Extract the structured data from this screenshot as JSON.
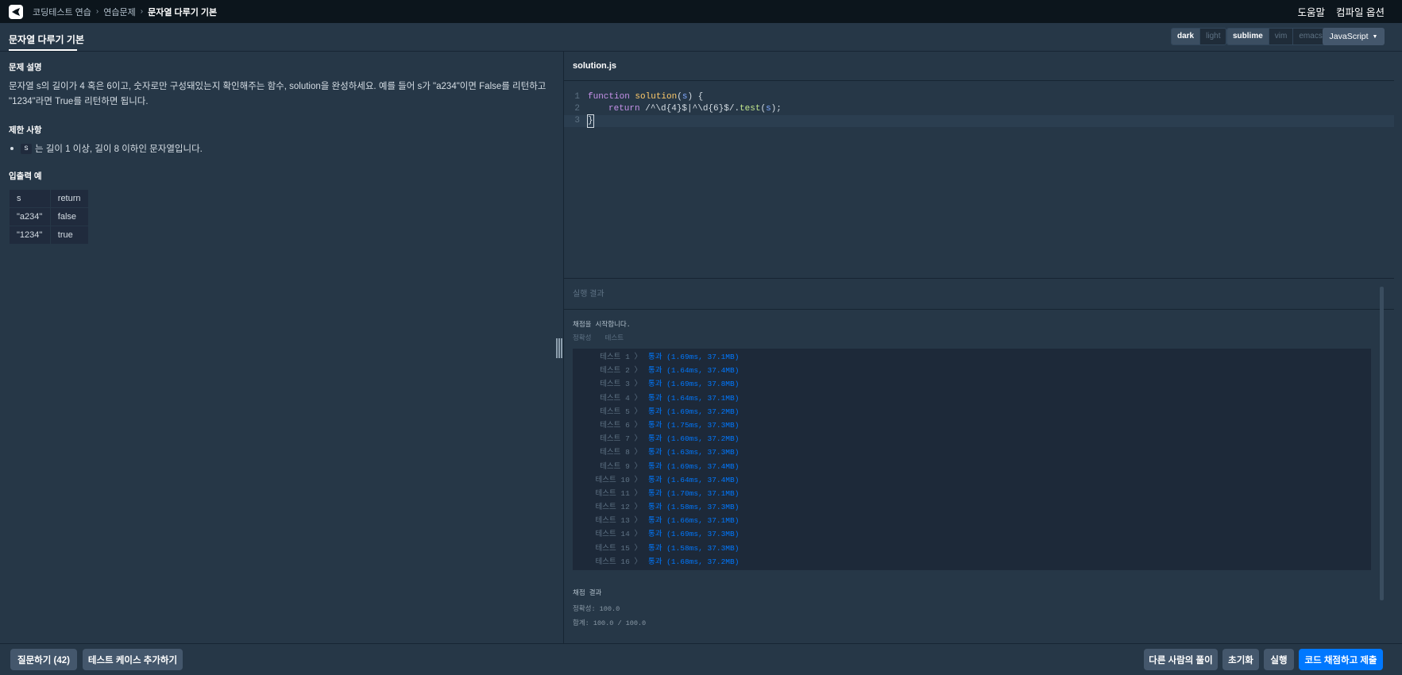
{
  "nav": {
    "breadcrumbs": [
      "코딩테스트 연습",
      "연습문제",
      "문자열 다루기 기본"
    ],
    "help": "도움말",
    "compile_options": "컴파일 옵션"
  },
  "title": {
    "problem_title": "문자열 다루기 기본",
    "themes": [
      "dark",
      "light"
    ],
    "keymaps": [
      "sublime",
      "vim",
      "emacs"
    ],
    "language": "JavaScript"
  },
  "problem": {
    "section_desc": "문제 설명",
    "desc_line1": "문자열 s의 길이가 4 혹은 6이고, 숫자로만 구성돼있는지 확인해주는 함수, solution을 완성하세요. 예를 들어 s가 \"a234\"이면 False를 리턴하고",
    "desc_line2": "\"1234\"라면 True를 리턴하면 됩니다.",
    "section_limits": "제한 사항",
    "limit_code": "s",
    "limit_text": "는 길이 1 이상, 길이 8 이하인 문자열입니다.",
    "section_io": "입출력 예",
    "io_table": [
      [
        "s",
        "return"
      ],
      [
        "\"a234\"",
        "false"
      ],
      [
        "\"1234\"",
        "true"
      ]
    ]
  },
  "editor": {
    "filename": "solution.js",
    "lines": [
      "1",
      "2",
      "3"
    ],
    "code": {
      "l1_kw": "function",
      "l1_fn": "solution",
      "l1_open": "(",
      "l1_param": "s",
      "l1_close": ") {",
      "l2_kw": "return",
      "l2_regex": "/^\\d{4}$|^\\d{6}$/",
      "l2_dot": ".",
      "l2_method": "test",
      "l2_open": "(",
      "l2_arg": "s",
      "l2_close": ");",
      "l3": "}"
    }
  },
  "results": {
    "header": "실행 결과",
    "start": "채점을 시작합니다.",
    "tabs": [
      "정확성",
      "테스트"
    ],
    "tests": [
      {
        "name": "테스트 1 〉",
        "result": "통과 (1.69ms, 37.1MB)"
      },
      {
        "name": "테스트 2 〉",
        "result": "통과 (1.64ms, 37.4MB)"
      },
      {
        "name": "테스트 3 〉",
        "result": "통과 (1.69ms, 37.8MB)"
      },
      {
        "name": "테스트 4 〉",
        "result": "통과 (1.64ms, 37.1MB)"
      },
      {
        "name": "테스트 5 〉",
        "result": "통과 (1.69ms, 37.2MB)"
      },
      {
        "name": "테스트 6 〉",
        "result": "통과 (1.75ms, 37.3MB)"
      },
      {
        "name": "테스트 7 〉",
        "result": "통과 (1.60ms, 37.2MB)"
      },
      {
        "name": "테스트 8 〉",
        "result": "통과 (1.63ms, 37.3MB)"
      },
      {
        "name": "테스트 9 〉",
        "result": "통과 (1.69ms, 37.4MB)"
      },
      {
        "name": "테스트 10 〉",
        "result": "통과 (1.64ms, 37.4MB)"
      },
      {
        "name": "테스트 11 〉",
        "result": "통과 (1.70ms, 37.1MB)"
      },
      {
        "name": "테스트 12 〉",
        "result": "통과 (1.58ms, 37.3MB)"
      },
      {
        "name": "테스트 13 〉",
        "result": "통과 (1.66ms, 37.1MB)"
      },
      {
        "name": "테스트 14 〉",
        "result": "통과 (1.69ms, 37.3MB)"
      },
      {
        "name": "테스트 15 〉",
        "result": "통과 (1.58ms, 37.3MB)"
      },
      {
        "name": "테스트 16 〉",
        "result": "통과 (1.68ms, 37.2MB)"
      }
    ],
    "score_title": "채점 결과",
    "accuracy": "정확성: 100.0",
    "total": "합계: 100.0 / 100.0"
  },
  "bottom": {
    "question": "질문하기 (42)",
    "add_testcase": "테스트 케이스 추가하기",
    "others": "다른 사람의 풀이",
    "reset": "초기화",
    "run": "실행",
    "submit": "코드 채점하고 제출"
  },
  "colors": {
    "background": "#263747",
    "topnav": "#0c151c",
    "primary": "#0078ff",
    "pass": "#0078ff"
  }
}
